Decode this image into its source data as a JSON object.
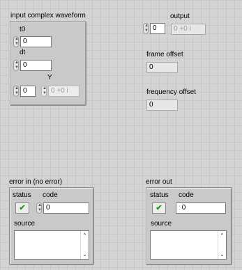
{
  "input_cluster": {
    "title": "input complex waveform",
    "t0_label": "t0",
    "t0_value": "0",
    "dt_label": "dt",
    "dt_value": "0",
    "y_label": "Y",
    "y_index": "0",
    "y_value": "0 +0 i"
  },
  "output": {
    "label": "output",
    "index": "0",
    "value": "0 +0 i"
  },
  "frame_offset": {
    "label": "frame offset",
    "value": "0"
  },
  "frequency_offset": {
    "label": "frequency offset",
    "value": "0"
  },
  "error_in": {
    "title": "error in (no error)",
    "status_label": "status",
    "code_label": "code",
    "code_value": "0",
    "source_label": "source",
    "status_check": "✔"
  },
  "error_out": {
    "title": "error out",
    "status_label": "status",
    "code_label": "code",
    "code_value": "0",
    "source_label": "source",
    "status_check": "✔"
  },
  "icons": {
    "increment": "▲",
    "decrement": "▼",
    "scroll_up": "⌃",
    "scroll_down": "⌄"
  }
}
